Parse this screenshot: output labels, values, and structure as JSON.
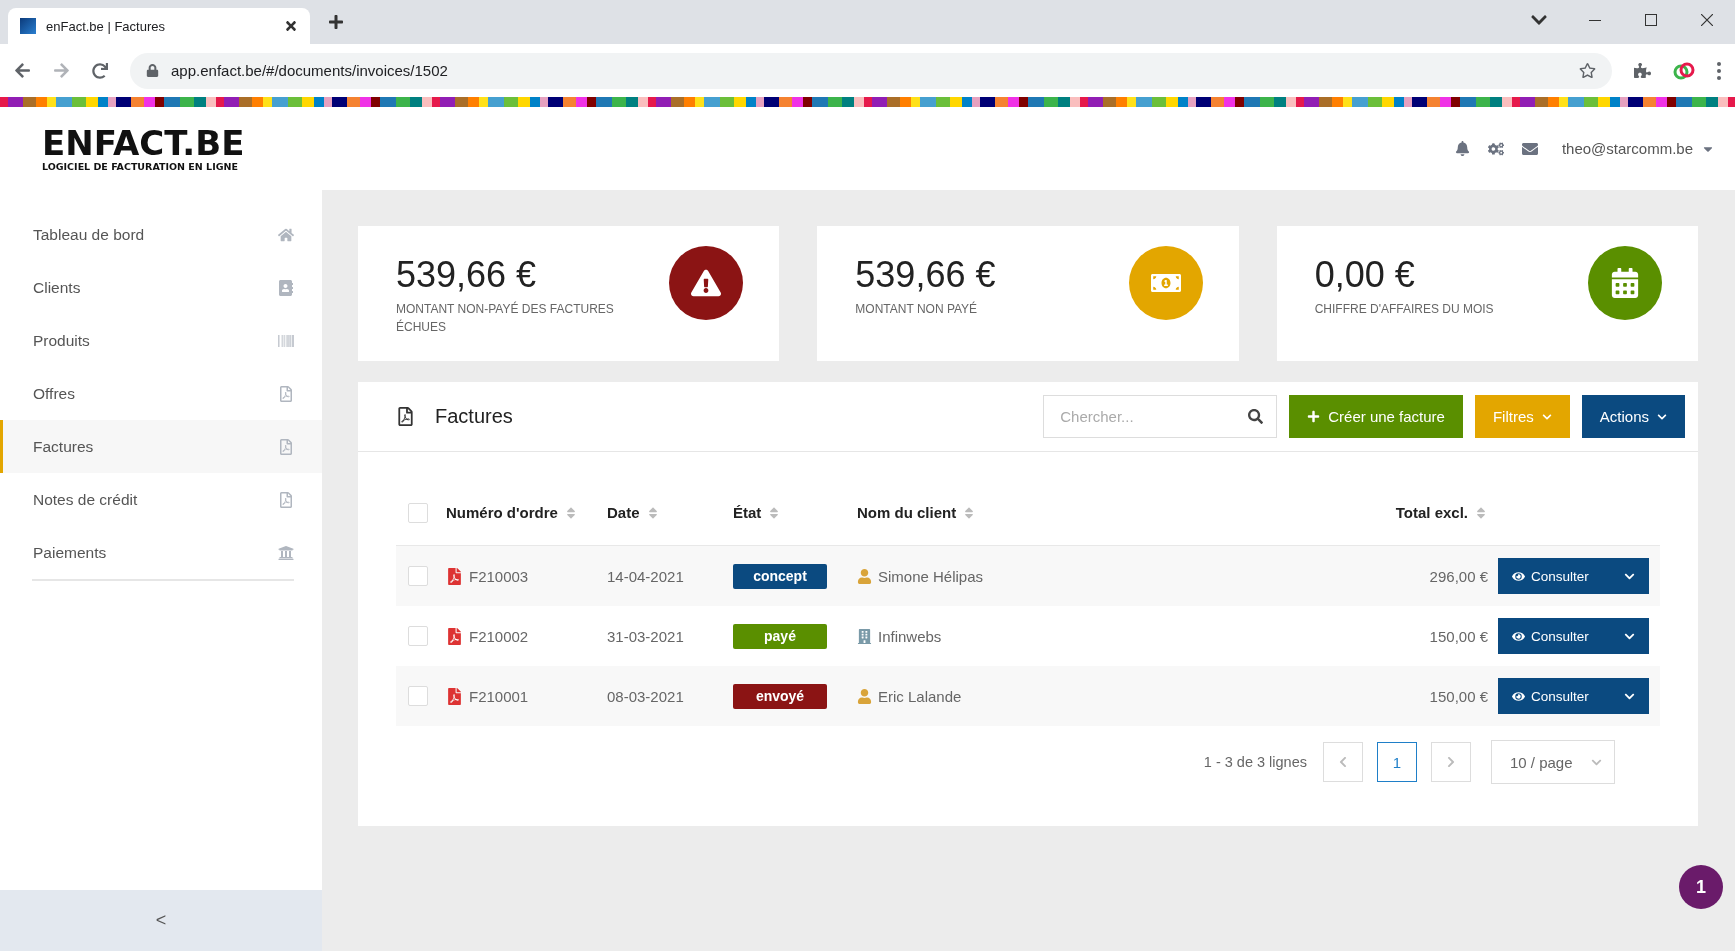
{
  "browser": {
    "tab_title": "enFact.be | Factures",
    "url": "app.enfact.be/#/documents/invoices/1502"
  },
  "header": {
    "logo_title": "ENFACT.BE",
    "logo_subtitle": "LOGICIEL DE FACTURATION EN LIGNE",
    "user": "theo@starcomm.be"
  },
  "sidebar": {
    "items": [
      {
        "label": "Tableau de bord",
        "selected": false
      },
      {
        "label": "Clients",
        "selected": false
      },
      {
        "label": "Produits",
        "selected": false
      },
      {
        "label": "Offres",
        "selected": false
      },
      {
        "label": "Factures",
        "selected": true
      },
      {
        "label": "Notes de crédit",
        "selected": false
      },
      {
        "label": "Paiements",
        "selected": false
      }
    ],
    "collapse": "<"
  },
  "stats": [
    {
      "value": "539,66 €",
      "label": "MONTANT NON-PAYÉ DES FACTURES ÉCHUES",
      "color": "#8b1414"
    },
    {
      "value": "539,66 €",
      "label": "MONTANT NON PAYÉ",
      "color": "#e3a600"
    },
    {
      "value": "0,00 €",
      "label": "CHIFFRE D'AFFAIRES DU MOIS",
      "color": "#5a8f00"
    }
  ],
  "panel": {
    "title": "Factures",
    "search": {
      "placeholder": "Chercher..."
    },
    "buttons": [
      {
        "label": "Créer une facture",
        "kind": "create",
        "color": "#5a8f00"
      },
      {
        "label": "Filtres",
        "kind": "menu",
        "color": "#e3a600"
      },
      {
        "label": "Actions",
        "kind": "menu",
        "color": "#0b4a80"
      }
    ]
  },
  "table": {
    "select_all": {
      "checked": false
    },
    "columns": [
      {
        "label": "Numéro d'ordre"
      },
      {
        "label": "Date"
      },
      {
        "label": "État"
      },
      {
        "label": "Nom du client"
      },
      {
        "label": "Total excl."
      }
    ],
    "rows": [
      {
        "checked": false,
        "number": "F210003",
        "date": "14-04-2021",
        "status": {
          "label": "concept",
          "color": "#0b4a80"
        },
        "client": {
          "name": "Simone Hélipas",
          "kind": "person"
        },
        "total": "296,00 €",
        "action": "Consulter"
      },
      {
        "checked": false,
        "number": "F210002",
        "date": "31-03-2021",
        "status": {
          "label": "payé",
          "color": "#5a8f00"
        },
        "client": {
          "name": "Infinwebs",
          "kind": "company"
        },
        "total": "150,00 €",
        "action": "Consulter"
      },
      {
        "checked": false,
        "number": "F210001",
        "date": "08-03-2021",
        "status": {
          "label": "envoyé",
          "color": "#8b1414"
        },
        "client": {
          "name": "Eric Lalande",
          "kind": "person"
        },
        "total": "150,00 €",
        "action": "Consulter"
      }
    ]
  },
  "pagination": {
    "summary": "1 - 3 de 3 lignes",
    "pages": [
      {
        "label": "1",
        "selected": true
      }
    ],
    "page_size": "10 / page"
  },
  "notification_badge": "1"
}
